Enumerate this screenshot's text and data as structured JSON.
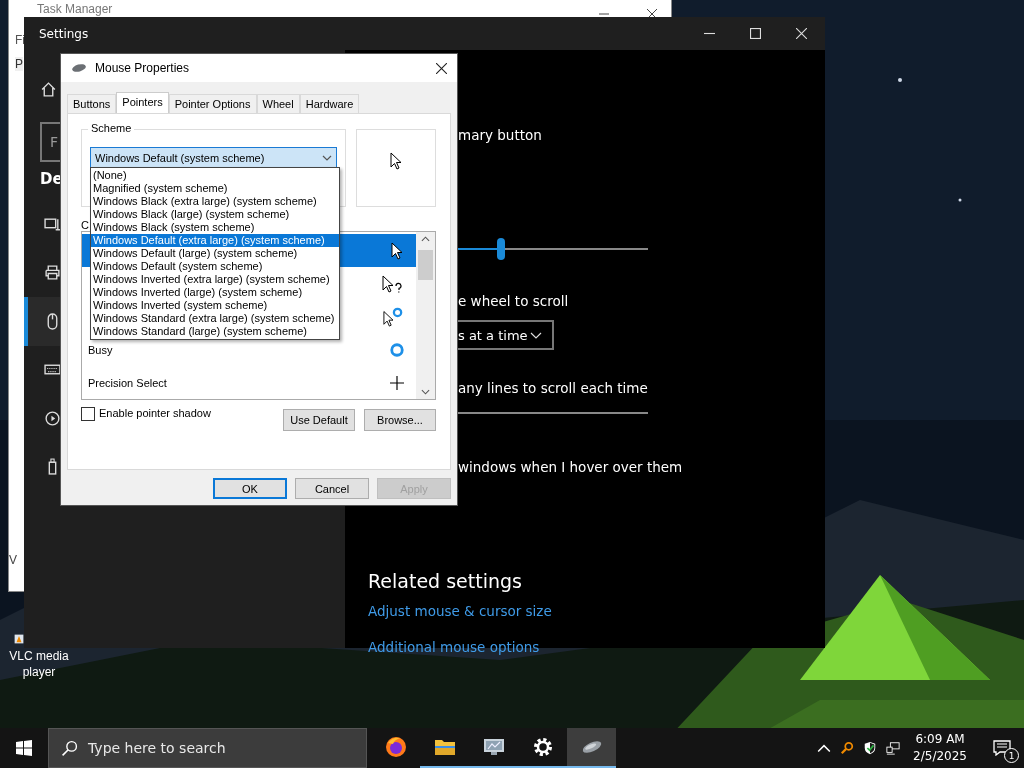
{
  "desktop": {
    "icons": [
      {
        "label": "VLC media player"
      }
    ]
  },
  "task_manager": {
    "title": "Task Manager",
    "menu_text": "Fi",
    "tab_text": "P",
    "footer_text": "V"
  },
  "settings": {
    "title": "Settings",
    "search": {
      "placeholder": "F"
    },
    "nav_heading": "De",
    "sidebar": [
      {
        "kind": "pen",
        "selected": false
      },
      {
        "kind": "printer",
        "selected": false
      },
      {
        "kind": "mouse",
        "selected": true
      },
      {
        "kind": "keyboard",
        "selected": false
      },
      {
        "kind": "autoplay",
        "selected": false
      },
      {
        "kind": "usb",
        "selected": false
      }
    ],
    "primary_button_label": "mary button",
    "speed_slider": {
      "level": 0.475
    },
    "scroll_label": "e wheel to scroll",
    "scroll_dropdown": "s at a time",
    "lines_label": "any lines to scroll each time",
    "inactive_label": "windows when I hover over them",
    "related_heading": "Related settings",
    "links": [
      "Adjust mouse & cursor size",
      "Additional mouse options"
    ]
  },
  "mouse_properties": {
    "title": "Mouse Properties",
    "tabs": [
      {
        "label": "Buttons",
        "selected": false
      },
      {
        "label": "Pointers",
        "selected": true
      },
      {
        "label": "Pointer Options",
        "selected": false
      },
      {
        "label": "Wheel",
        "selected": false
      },
      {
        "label": "Hardware",
        "selected": false
      }
    ],
    "scheme_label": "Scheme",
    "scheme_value": "Windows Default (system scheme)",
    "scheme_options": [
      {
        "label": "(None)",
        "selected": false
      },
      {
        "label": "Magnified (system scheme)",
        "selected": false
      },
      {
        "label": "Windows Black (extra large) (system scheme)",
        "selected": false
      },
      {
        "label": "Windows Black (large) (system scheme)",
        "selected": false
      },
      {
        "label": "Windows Black (system scheme)",
        "selected": false
      },
      {
        "label": "Windows Default (extra large) (system scheme)",
        "selected": true
      },
      {
        "label": "Windows Default (large) (system scheme)",
        "selected": false
      },
      {
        "label": "Windows Default (system scheme)",
        "selected": false
      },
      {
        "label": "Windows Inverted (extra large) (system scheme)",
        "selected": false
      },
      {
        "label": "Windows Inverted (large) (system scheme)",
        "selected": false
      },
      {
        "label": "Windows Inverted (system scheme)",
        "selected": false
      },
      {
        "label": "Windows Standard (extra large) (system scheme)",
        "selected": false
      },
      {
        "label": "Windows Standard (large) (system scheme)",
        "selected": false
      }
    ],
    "customize_label": "C",
    "cursors": [
      {
        "kind": "arrow",
        "selected": true
      },
      {
        "kind": "help",
        "selected": false
      },
      {
        "kind": "working",
        "selected": false
      },
      {
        "name": "Busy",
        "kind": "busy",
        "selected": false
      },
      {
        "name": "Precision Select",
        "kind": "precision",
        "selected": false
      }
    ],
    "pointer_shadow": {
      "label": "Enable pointer shadow",
      "checked": false
    },
    "buttons": [
      {
        "label": "Use Default",
        "disabled": false
      },
      {
        "label": "Browse...",
        "disabled": false
      }
    ],
    "footer_buttons": [
      {
        "label": "OK",
        "default": true,
        "disabled": false
      },
      {
        "label": "Cancel",
        "default": false,
        "disabled": false
      },
      {
        "label": "Apply",
        "default": false,
        "disabled": true
      }
    ]
  },
  "taskbar": {
    "search": {
      "placeholder": "Type here to search"
    },
    "apps": [
      {
        "kind": "firefox",
        "running": false,
        "selected": false
      },
      {
        "kind": "folder",
        "running": true,
        "selected": false
      },
      {
        "kind": "monitor",
        "running": true,
        "selected": false
      },
      {
        "kind": "gear",
        "running": true,
        "selected": false
      },
      {
        "kind": "mouse",
        "running": true,
        "selected": true
      }
    ],
    "time": "6:09 AM",
    "date": "2/5/2025",
    "notifications": "1"
  }
}
